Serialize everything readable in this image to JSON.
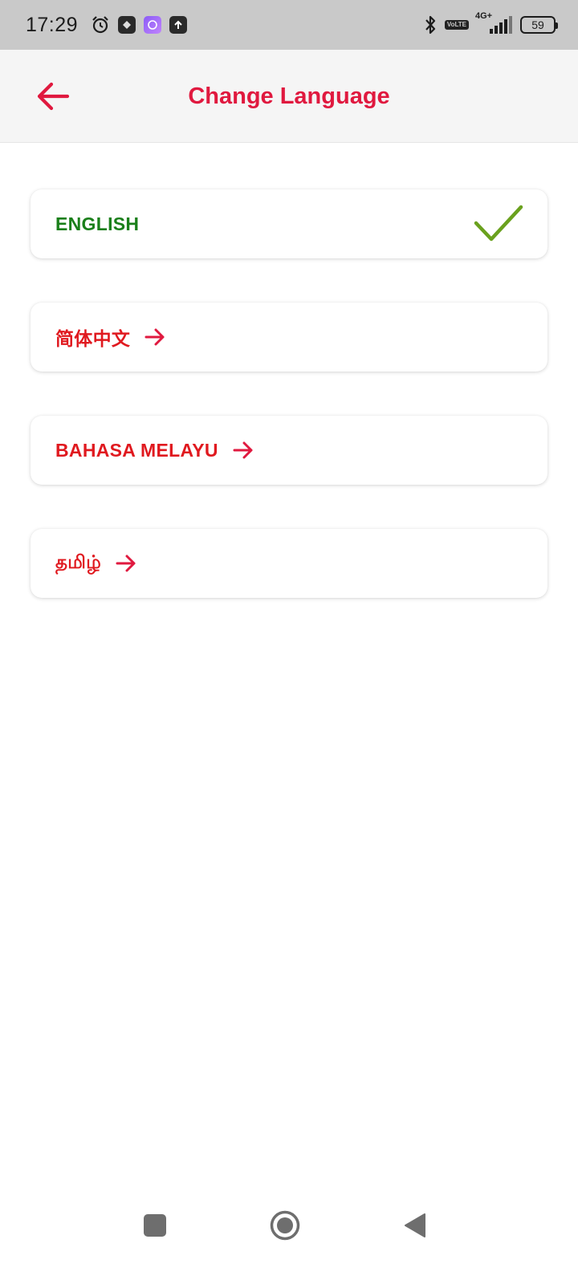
{
  "status_bar": {
    "time": "17:29",
    "icons": [
      "alarm-icon",
      "app-badge-icon",
      "app-badge-icon",
      "upload-icon",
      "bluetooth-icon",
      "volte-icon",
      "signal-icon",
      "battery-icon"
    ],
    "volte_top": "Vo",
    "volte_bottom": "LTE",
    "network_type": "4G+",
    "battery_level": "59"
  },
  "header": {
    "title": "Change Language",
    "back_icon": "arrow-left-icon",
    "accent_color": "#e0193f",
    "background": "#f5f5f5"
  },
  "languages": [
    {
      "label": "ENGLISH",
      "selected": true,
      "indicator": "check-icon"
    },
    {
      "label": "简体中文",
      "selected": false,
      "indicator": "arrow-right-icon"
    },
    {
      "label": "BAHASA MELAYU",
      "selected": false,
      "indicator": "arrow-right-icon"
    },
    {
      "label": "தமிழ்",
      "selected": false,
      "indicator": "arrow-right-icon"
    }
  ],
  "colors": {
    "selected_text": "#1a7f1a",
    "check": "#6aa11e",
    "unselected_text": "#e0191f",
    "arrow": "#e0193f"
  },
  "nav_bar": {
    "buttons": [
      "recents-square-icon",
      "home-circle-icon",
      "back-triangle-icon"
    ]
  }
}
